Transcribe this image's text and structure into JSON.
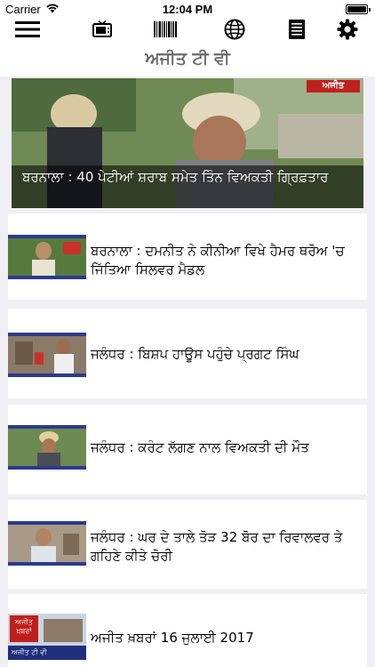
{
  "status_bar": {
    "carrier": "Carrier",
    "time": "12:04 PM"
  },
  "toolbar": {
    "icons": [
      "menu-icon",
      "tv-icon",
      "barcode-icon",
      "globe-icon",
      "list-icon",
      "gear-icon"
    ]
  },
  "app": {
    "title": "ਅਜੀਤ ਟੀ ਵੀ"
  },
  "featured": {
    "headline": "ਬਰਨਾਲਾ : 40 ਪੇਟੀਆਂ ਸ਼ਰਾਬ ਸਮੇਤ ਤਿੰਨ ਵਿਅਕਤੀ ਗ੍ਰਿਫ਼ਤਾਰ",
    "channel_logo": "ਅਜੀਤ"
  },
  "news": [
    {
      "headline": "ਬਰਨਾਲਾ : ਦਮਨੀਤ ਨੇ ਕੀਨੀਆ ਵਿਖੇ ਹੈਮਰ ਥਰੋਅ 'ਚ ਜਿੱਤਿਆ ਸਿਲਵਰ ਮੈਡਲ"
    },
    {
      "headline": "ਜਲੰਧਰ : ਬਿਸ਼ਪ ਹਾਊਸ ਪਹੁੰਚੇ ਪ੍ਰਗਟ ਸਿੰਘ"
    },
    {
      "headline": "ਜਲੰਧਰ : ਕਰੰਟ ਲੱਗਣ ਨਾਲ ਵਿਅਕਤੀ ਦੀ ਮੌਤ"
    },
    {
      "headline": "ਜਲੰਧਰ : ਘਰ ਦੇ ਤਾਲੇ ਤੋੜ 32 ਬੋਰ ਦਾ ਰਿਵਾਲਵਰ ਤੇ ਗਹਿਣੇ ਕੀਤੇ ਚੋਰੀ"
    },
    {
      "headline": "ਅਜੀਤ ਖ਼ਬਰਾਂ 16 ਜੁਲਾਈ 2017",
      "thumb_text": [
        "ਅਜੀਤ",
        "ਖ਼ਬਰਾਂ",
        "ਅਜੀਤ",
        "ਟੀ ਵੀ"
      ]
    }
  ]
}
